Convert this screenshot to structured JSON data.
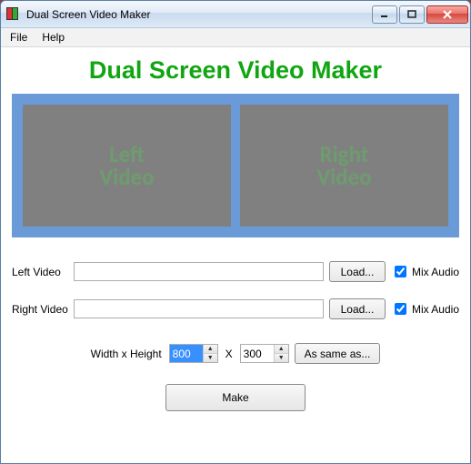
{
  "window": {
    "title": "Dual Screen Video Maker"
  },
  "menu": {
    "file": "File",
    "help": "Help"
  },
  "heading": "Dual Screen Video Maker",
  "preview": {
    "left": "Left\nVideo",
    "right": "Right\nVideo"
  },
  "rows": {
    "left": {
      "label": "Left Video",
      "value": "",
      "load": "Load...",
      "mix_label": "Mix Audio",
      "mix_checked": true
    },
    "right": {
      "label": "Right Video",
      "value": "",
      "load": "Load...",
      "mix_label": "Mix Audio",
      "mix_checked": true
    }
  },
  "dims": {
    "label": "Width x Height",
    "width": "800",
    "sep": "X",
    "height": "300",
    "same": "As same as..."
  },
  "make": "Make"
}
